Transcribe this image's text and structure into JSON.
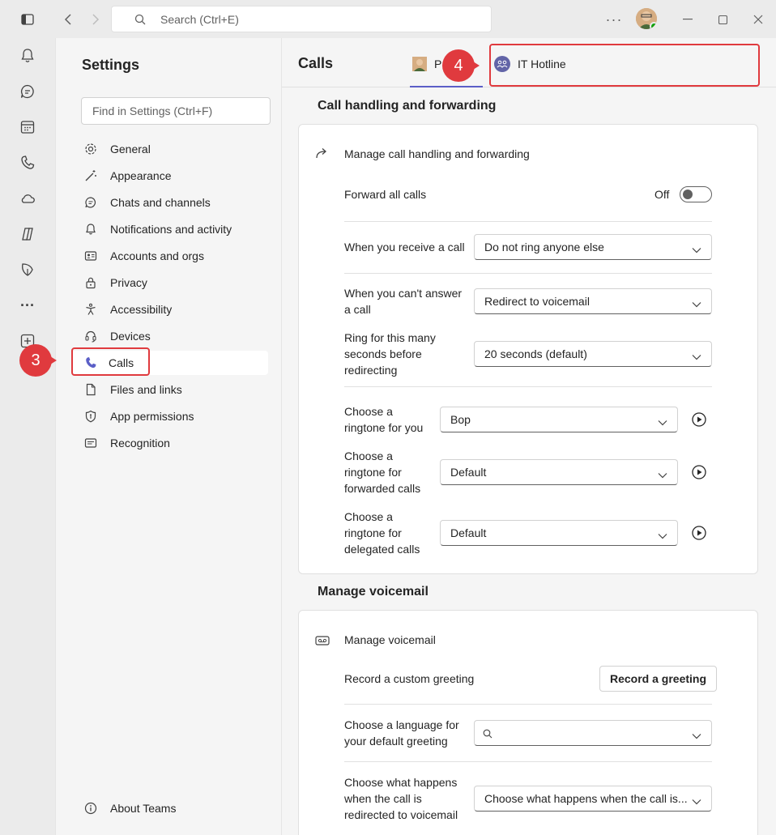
{
  "titlebar": {
    "search_placeholder": "Search (Ctrl+E)"
  },
  "rail": {
    "items": [
      "bell-icon",
      "chat-icon",
      "calendar-icon",
      "phone-icon",
      "onedrive-icon",
      "copilot-icon",
      "viva-icon",
      "more-icon",
      "add-apps-icon"
    ]
  },
  "settings": {
    "title": "Settings",
    "search_placeholder": "Find in Settings (Ctrl+F)",
    "nav": [
      {
        "label": "General",
        "icon": "gear-icon"
      },
      {
        "label": "Appearance",
        "icon": "wand-icon"
      },
      {
        "label": "Chats and channels",
        "icon": "chat-icon"
      },
      {
        "label": "Notifications and activity",
        "icon": "bell-icon"
      },
      {
        "label": "Accounts and orgs",
        "icon": "id-card-icon"
      },
      {
        "label": "Privacy",
        "icon": "lock-icon"
      },
      {
        "label": "Accessibility",
        "icon": "accessibility-icon"
      },
      {
        "label": "Devices",
        "icon": "headset-icon"
      },
      {
        "label": "Calls",
        "icon": "phone-icon",
        "active": true
      },
      {
        "label": "Files and links",
        "icon": "file-icon"
      },
      {
        "label": "App permissions",
        "icon": "shield-icon"
      },
      {
        "label": "Recognition",
        "icon": "recognition-icon"
      }
    ],
    "about": "About Teams"
  },
  "main": {
    "title": "Calls",
    "tabs": [
      {
        "label": "P"
      },
      {
        "label": "IT Hotline"
      }
    ],
    "call_handling": {
      "section_title": "Call handling and forwarding",
      "manage_label": "Manage call handling and forwarding",
      "forward_all_label": "Forward all calls",
      "forward_all_state": "Off",
      "receive_label": "When you receive a call",
      "receive_value": "Do not ring anyone else",
      "cant_answer_label_1": "When you can't answer",
      "cant_answer_label_2": "a call",
      "cant_answer_value": "Redirect to voicemail",
      "ring_label_1": "Ring for this many",
      "ring_label_2": "seconds before",
      "ring_label_3": "redirecting",
      "ring_value": "20 seconds (default)",
      "ringtone_you_1": "Choose a",
      "ringtone_you_2": "ringtone for you",
      "ringtone_you_value": "Bop",
      "ringtone_fwd_1": "Choose a",
      "ringtone_fwd_2": "ringtone for",
      "ringtone_fwd_3": "forwarded calls",
      "ringtone_fwd_value": "Default",
      "ringtone_del_1": "Choose a",
      "ringtone_del_2": "ringtone for",
      "ringtone_del_3": "delegated calls",
      "ringtone_del_value": "Default"
    },
    "voicemail": {
      "section_title": "Manage voicemail",
      "manage_label": "Manage voicemail",
      "greeting_label": "Record a custom greeting",
      "greeting_button": "Record a greeting",
      "language_label_1": "Choose a language for",
      "language_label_2": "your default greeting",
      "language_value": "",
      "redirect_label_1": "Choose what happens",
      "redirect_label_2": "when the call is",
      "redirect_label_3": "redirected to voicemail",
      "redirect_value": "Choose what happens when the call is..."
    }
  },
  "callouts": {
    "step3": "3",
    "step4": "4",
    "color": "#e03a3e"
  }
}
